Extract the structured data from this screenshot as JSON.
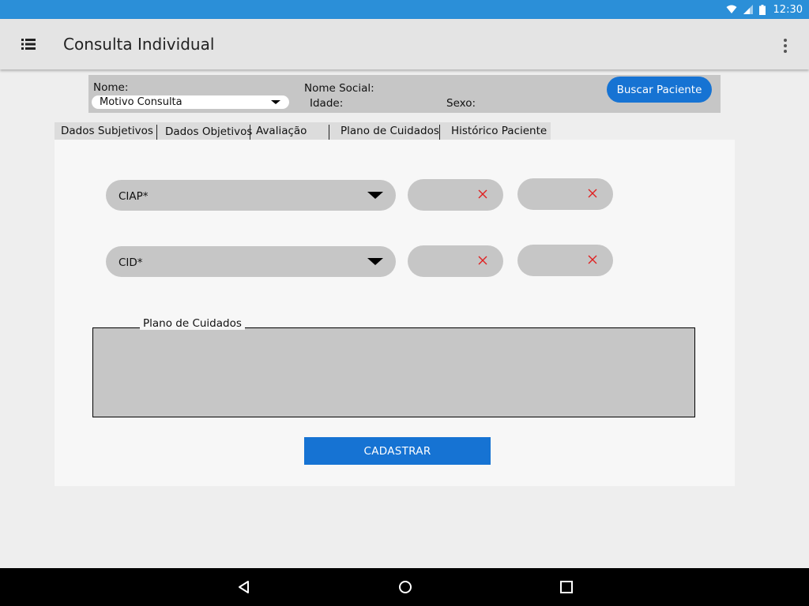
{
  "status_bar": {
    "time": "12:30",
    "icons": [
      "wifi-icon",
      "signal-icon",
      "battery-icon"
    ],
    "color": "#2b8fd8"
  },
  "app_bar": {
    "title": "Consulta Individual",
    "icons": [
      "list-menu-icon",
      "more-vert-icon"
    ]
  },
  "patient": {
    "nome_label": "Nome:",
    "motivo_value": "Motivo Consulta",
    "nome_social_label": "Nome Social:",
    "idade_label": "Idade:",
    "sexo_label": "Sexo:",
    "buscar_button": "Buscar Paciente"
  },
  "tabs": [
    {
      "label": "Dados Subjetivos"
    },
    {
      "label": "Dados Objetivos"
    },
    {
      "label": "Avaliação"
    },
    {
      "label": "Plano de Cuidados"
    },
    {
      "label": "Histórico Paciente"
    }
  ],
  "form": {
    "ciap_placeholder": "CIAP*",
    "cid_placeholder": "CID*",
    "plano_legend": "Plano de Cuidados",
    "submit_label": "CADASTRAR"
  },
  "colors": {
    "accent": "#1673d3",
    "remove_x": "#e02020",
    "field_bg": "#c6c6c6"
  },
  "nav_bar": {
    "icons": [
      "back-icon",
      "home-icon",
      "recents-icon"
    ]
  }
}
